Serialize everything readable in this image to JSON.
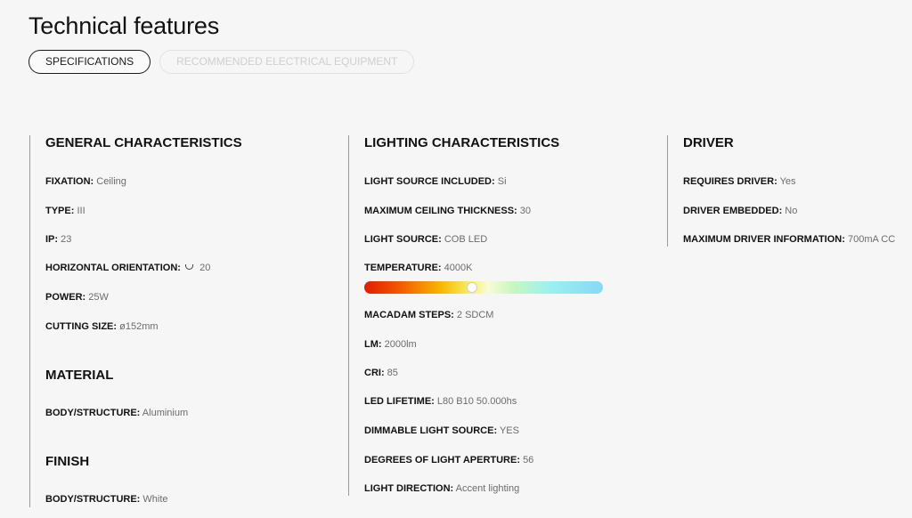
{
  "page_title": "Technical features",
  "tabs": [
    {
      "label": "SPECIFICATIONS",
      "active": true
    },
    {
      "label": "RECOMMENDED ELECTRICAL EQUIPMENT",
      "active": false
    }
  ],
  "general": {
    "title": "GENERAL CHARACTERISTICS",
    "fixation": {
      "label": "FIXATION:",
      "value": "Ceiling"
    },
    "type": {
      "label": "TYPE:",
      "value": "III"
    },
    "ip": {
      "label": "IP:",
      "value": "23"
    },
    "orientation": {
      "label": "HORIZONTAL ORIENTATION:",
      "value": "20",
      "icon": "rotate-icon"
    },
    "power": {
      "label": "POWER:",
      "value": "25W"
    },
    "cutting": {
      "label": "CUTTING SIZE:",
      "value": "ø152mm"
    }
  },
  "material": {
    "title": "MATERIAL",
    "body": {
      "label": "BODY/STRUCTURE:",
      "value": "Aluminium"
    }
  },
  "finish": {
    "title": "FINISH",
    "body": {
      "label": "BODY/STRUCTURE:",
      "value": "White"
    }
  },
  "lighting": {
    "title": "LIGHTING CHARACTERISTICS",
    "source_included": {
      "label": "LIGHT SOURCE INCLUDED:",
      "value": "Si"
    },
    "ceiling_thickness": {
      "label": "MAXIMUM CEILING THICKNESS:",
      "value": "30"
    },
    "source": {
      "label": "LIGHT SOURCE:",
      "value": "COB LED"
    },
    "temperature": {
      "label": "TEMPERATURE:",
      "value": "4000K",
      "scale_position": 0.45
    },
    "macadam": {
      "label": "MACADAM STEPS:",
      "value": "2 SDCM"
    },
    "lm": {
      "label": "LM:",
      "value": "2000lm"
    },
    "cri": {
      "label": "CRI:",
      "value": "85"
    },
    "lifetime": {
      "label": "LED LIFETIME:",
      "value": "L80 B10 50.000hs"
    },
    "dimmable": {
      "label": "DIMMABLE LIGHT SOURCE:",
      "value": "YES"
    },
    "aperture": {
      "label": "DEGREES OF LIGHT APERTURE:",
      "value": "56"
    },
    "direction": {
      "label": "LIGHT DIRECTION:",
      "value": "Accent lighting"
    }
  },
  "driver": {
    "title": "DRIVER",
    "requires": {
      "label": "REQUIRES DRIVER:",
      "value": "Yes"
    },
    "embedded": {
      "label": "DRIVER EMBEDDED:",
      "value": "No"
    },
    "max_info": {
      "label": "MAXIMUM DRIVER INFORMATION:",
      "value": "700mA CC"
    }
  },
  "colors": {
    "text": "#111111",
    "value_text": "#6b6b6b",
    "background": "#f6f6f6",
    "divider": "#9a9a9a"
  }
}
